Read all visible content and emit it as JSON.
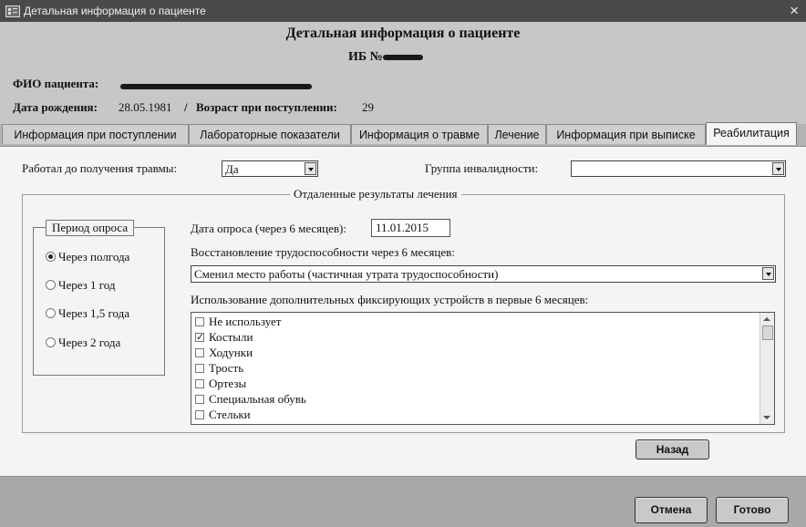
{
  "window": {
    "title": "Детальная информация о пациенте",
    "close_glyph": "×",
    "app_icon": "form-icon"
  },
  "header": {
    "title": "Детальная информация о пациенте",
    "ib_label": "ИБ №",
    "fio_label": "ФИО пациента:",
    "birth_label": "Дата рождения:",
    "birth_value": "28.05.1981",
    "separator": "/",
    "age_label": "Возраст при поступлении:",
    "age_value": "29"
  },
  "tabs": [
    {
      "label": "Информация при поступлении"
    },
    {
      "label": "Лабораторные показатели"
    },
    {
      "label": "Информация о травме"
    },
    {
      "label": "Лечение"
    },
    {
      "label": "Информация при выписке"
    },
    {
      "label": "Реабилитация"
    }
  ],
  "rehab": {
    "worked_label": "Работал до получения травмы:",
    "worked_value": "Да",
    "disability_label": "Группа инвалидности:",
    "disability_value": "",
    "section_title": "Отдаленные результаты лечения",
    "period": {
      "title": "Период опроса",
      "options": [
        "Через полгода",
        "Через 1 год",
        "Через 1,5 года",
        "Через 2 года"
      ],
      "selected": "Через полгода"
    },
    "survey_date_label": "Дата опроса (через 6 месяцев):",
    "survey_date_value": "11.01.2015",
    "recovery_label": "Восстановление трудоспособности через 6 месяцев:",
    "recovery_value": "Сменил место работы (частичная утрата трудоспособности)",
    "devices_label": "Использование дополнительных фиксирующих устройств в первые 6 месяцев:",
    "devices": [
      {
        "label": "Не использует",
        "checked": false
      },
      {
        "label": "Костыли",
        "checked": true
      },
      {
        "label": "Ходунки",
        "checked": false
      },
      {
        "label": "Трость",
        "checked": false
      },
      {
        "label": "Ортезы",
        "checked": false
      },
      {
        "label": "Специальная обувь",
        "checked": false
      },
      {
        "label": "Стельки",
        "checked": false
      }
    ],
    "back_button": "Назад"
  },
  "footer": {
    "cancel_button": "Отмена",
    "ok_button": "Готово"
  }
}
